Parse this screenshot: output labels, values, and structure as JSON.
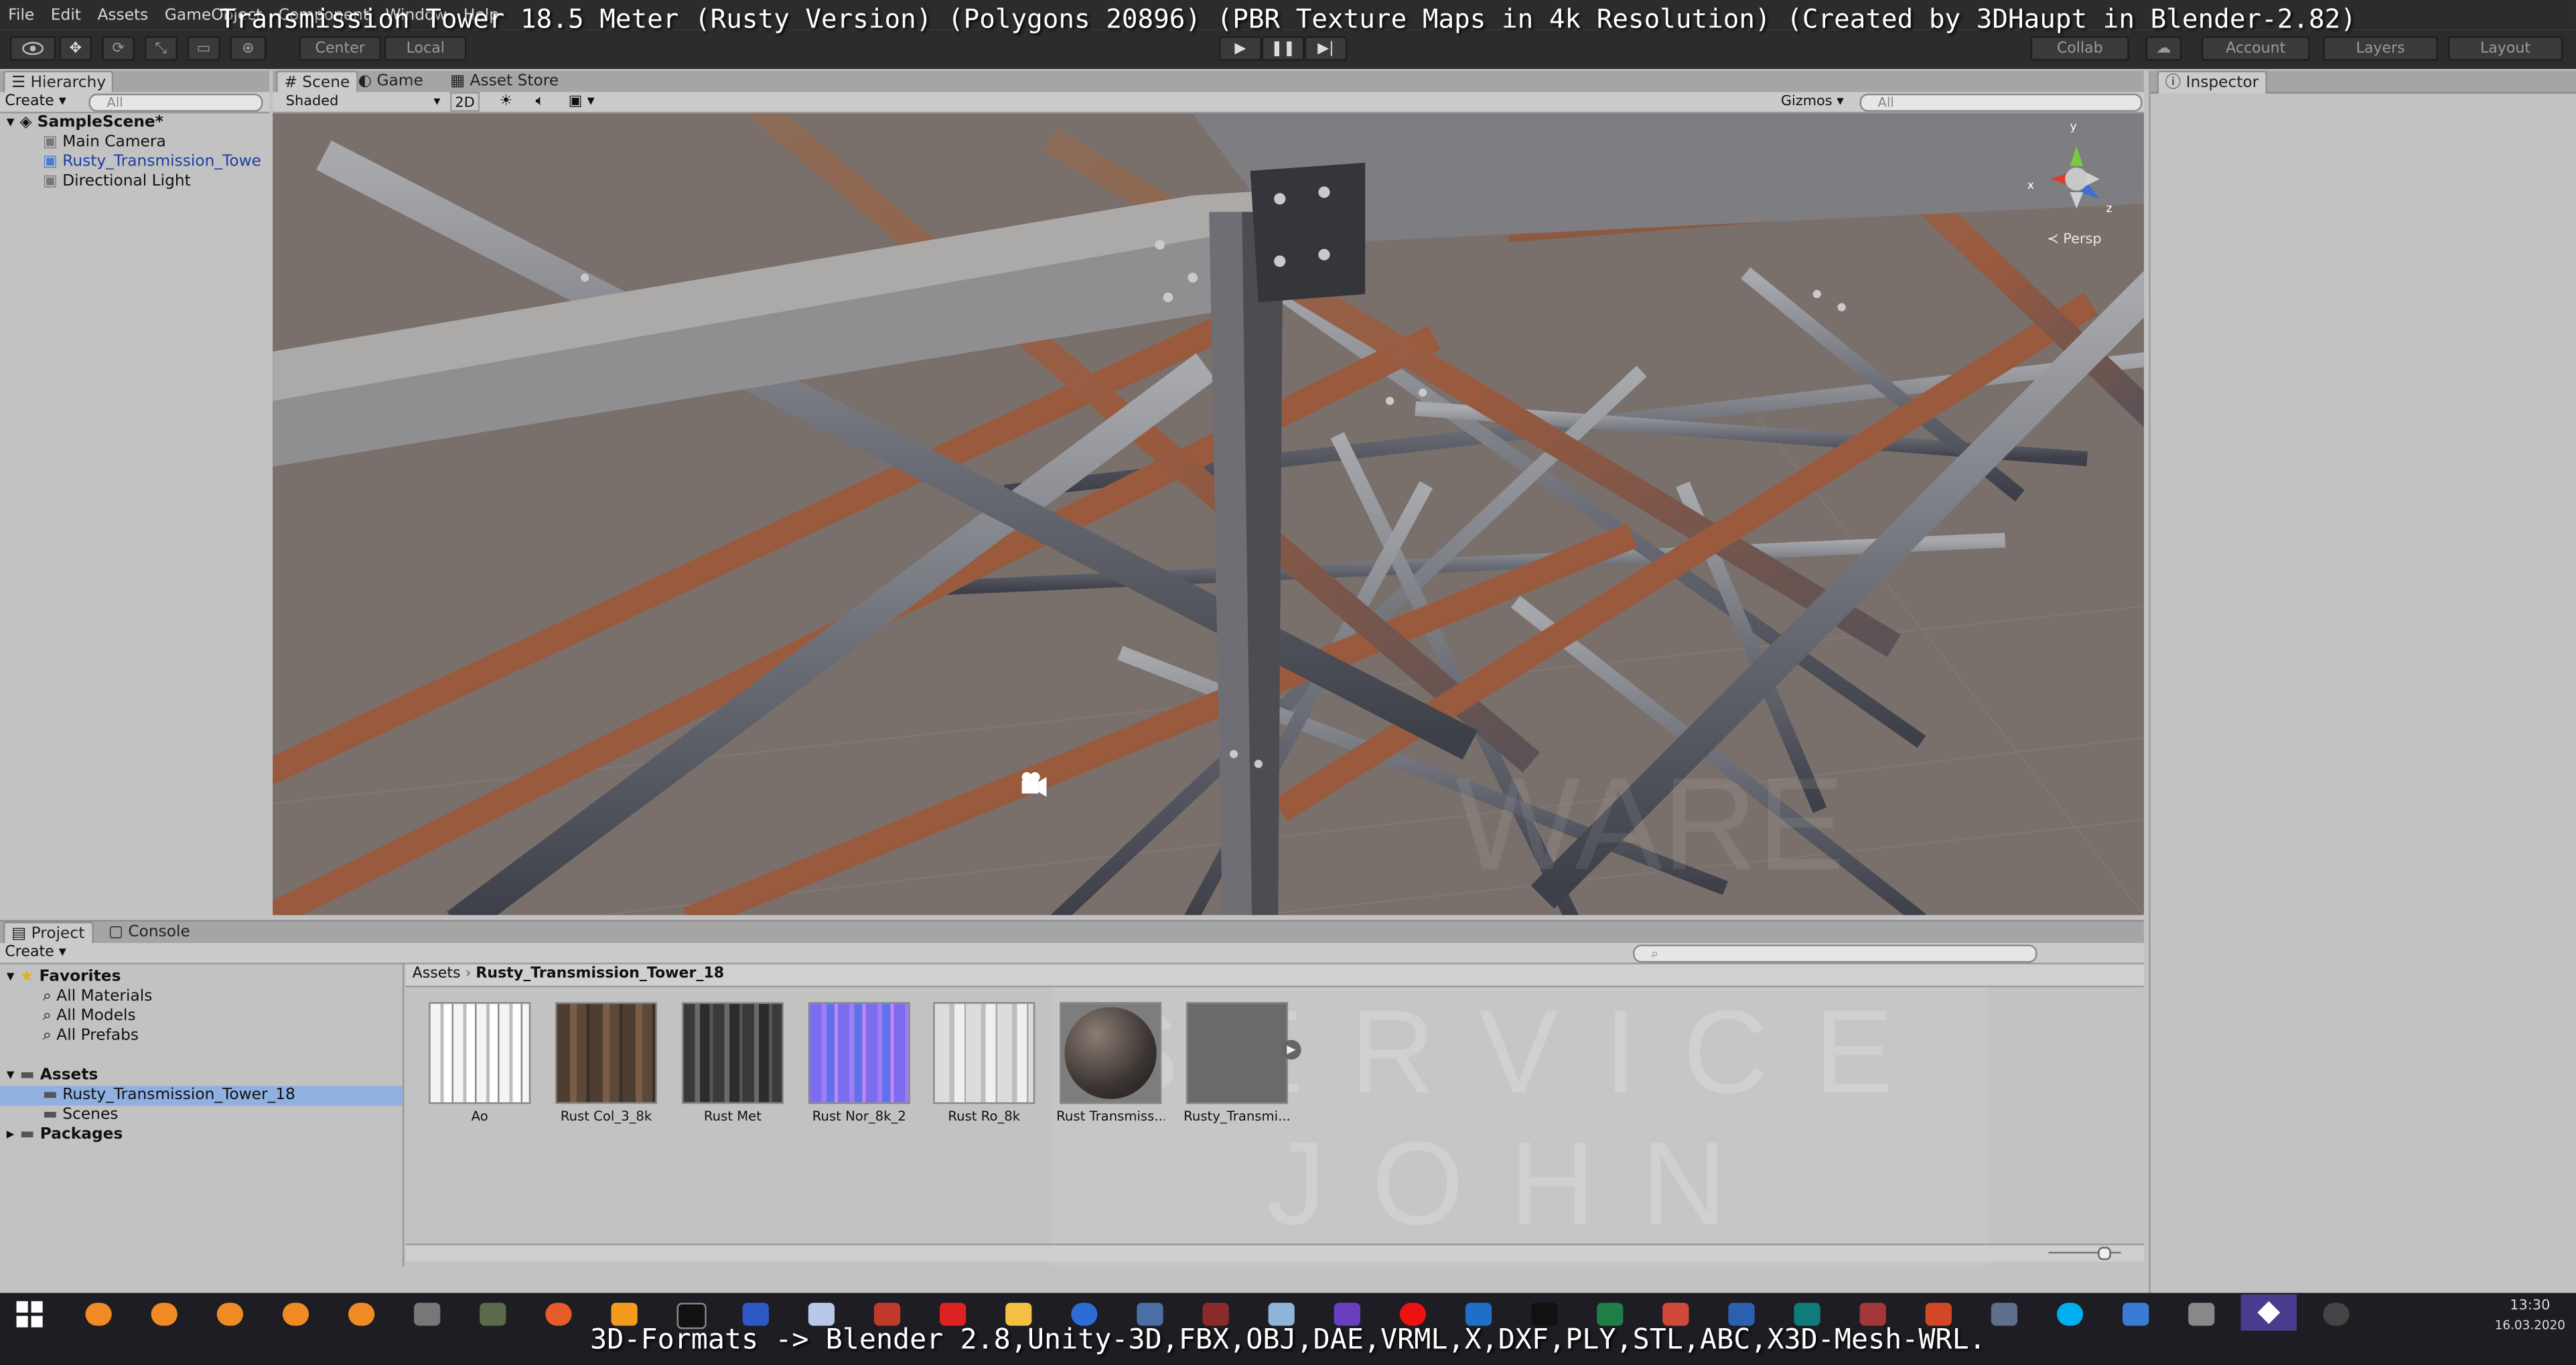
{
  "window": {
    "title_overlay": "Transmission Tower 18.5 Meter (Rusty Version) (Polygons 20896) (PBR Texture Maps in 4k Resolution) (Created by 3DHaupt in Blender-2.82)",
    "menu": [
      "File",
      "Edit",
      "Assets",
      "GameObject",
      "Component",
      "Window",
      "Help"
    ]
  },
  "toolbar": {
    "center_label": "Center",
    "local_label": "Local",
    "collab_label": "Collab",
    "account_label": "Account",
    "layers_label": "Layers",
    "layout_label": "Layout"
  },
  "hierarchy": {
    "tab_label": "Hierarchy",
    "create_label": "Create",
    "search_placeholder": "All",
    "scene_name": "SampleScene*",
    "items": [
      "Main Camera",
      "Rusty_Transmission_Towe",
      "Directional Light"
    ]
  },
  "scene_view": {
    "tabs": [
      "Scene",
      "Game",
      "Asset Store"
    ],
    "shading_mode": "Shaded",
    "mode_2d": "2D",
    "gizmos_label": "Gizmos",
    "search_placeholder": "All",
    "persp_label": "Persp",
    "axis_labels": {
      "x": "x",
      "y": "y",
      "z": "z"
    }
  },
  "inspector": {
    "tab_label": "Inspector"
  },
  "project": {
    "tabs": [
      "Project",
      "Console"
    ],
    "create_label": "Create",
    "breadcrumb": [
      "Assets",
      "Rusty_Transmission_Tower_18"
    ],
    "favorites_label": "Favorites",
    "favorites": [
      "All Materials",
      "All Models",
      "All Prefabs"
    ],
    "assets_label": "Assets",
    "asset_folders": [
      "Rusty_Transmission_Tower_18",
      "Scenes"
    ],
    "packages_label": "Packages",
    "files": [
      {
        "label": "Ao",
        "color": "#eaeaea"
      },
      {
        "label": "Rust Col_3_8k",
        "color": "#5a4a3c"
      },
      {
        "label": "Rust Met",
        "color": "#4a4a4a"
      },
      {
        "label": "Rust Nor_8k_2",
        "color": "#7b6cf0"
      },
      {
        "label": "Rust Ro_8k",
        "color": "#d8d8d8"
      },
      {
        "label": "Rust Transmiss...",
        "color": "#3b3532"
      },
      {
        "label": "Rusty_Transmi...",
        "color": "#6a6a6a"
      }
    ],
    "watermark": "SERVICE JOHN"
  },
  "taskbar": {
    "time": "13:30",
    "date": "16.03.2020",
    "caption": "3D-Formats -> Blender 2.8,Unity-3D,FBX,OBJ,DAE,VRML,X,DXF,PLY,STL,ABC,X3D-Mesh-WRL."
  },
  "colors": {
    "editor_bg": "#c2c2c2",
    "toolbar_bg": "#2c2c2c",
    "selection": "#8fb0e0",
    "taskbar_bg": "#1d1d23"
  }
}
